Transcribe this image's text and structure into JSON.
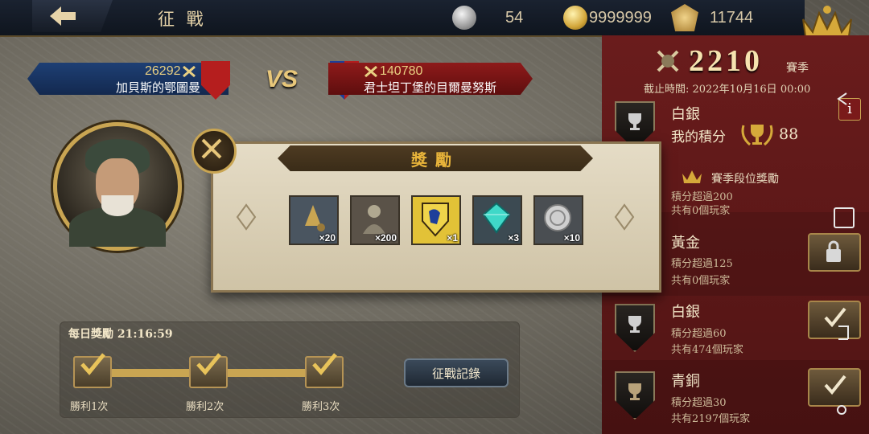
{
  "header": {
    "title": "征 戰",
    "silver_count": "54",
    "gold_count": "9999999",
    "crest_count": "11744"
  },
  "teams": {
    "left": {
      "score": "26292",
      "name": "加貝斯的鄂圖曼"
    },
    "right": {
      "score": "140780",
      "name": "君士坦丁堡的目爾曼努斯"
    },
    "vs": "VS"
  },
  "daily": {
    "title": "每日獎勵 21:16:59",
    "milestones": [
      "勝利1次",
      "勝利2次",
      "勝利3次"
    ],
    "record_button": "征戰記錄"
  },
  "modal": {
    "title": "獎勵",
    "rewards": [
      {
        "icon": "bell-icon",
        "qty": "×20"
      },
      {
        "icon": "soldier-icon",
        "qty": "×200"
      },
      {
        "icon": "lion-shield-icon",
        "qty": "×1"
      },
      {
        "icon": "gem-icon",
        "qty": "×3"
      },
      {
        "icon": "silver-coin-icon",
        "qty": "×10"
      }
    ]
  },
  "season": {
    "score": "2210",
    "label": "賽季",
    "deadline": "截止時間: 2022年10月16日 00:00",
    "current_tier": "白銀",
    "my_points_label": "我的積分",
    "my_points": "88",
    "tier_rewards_label": "賽季段位獎勵",
    "tiers": [
      {
        "name": "",
        "line1": "積分超過200",
        "line2": "共有0個玩家"
      },
      {
        "name": "黃金",
        "line1": "積分超過125",
        "line2": "共有0個玩家"
      },
      {
        "name": "白銀",
        "line1": "積分超過60",
        "line2": "共有474個玩家"
      },
      {
        "name": "青銅",
        "line1": "積分超過30",
        "line2": "共有2197個玩家"
      }
    ]
  },
  "colors": {
    "accent_gold": "#c9a552",
    "panel_red": "#6a1c1c",
    "banner_blue": "#1e3f74"
  }
}
